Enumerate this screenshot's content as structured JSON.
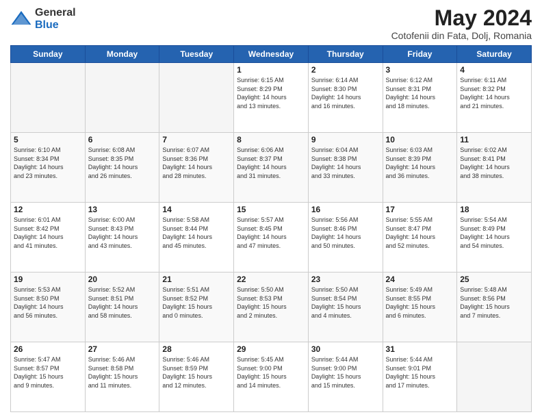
{
  "logo": {
    "general": "General",
    "blue": "Blue"
  },
  "header": {
    "month_year": "May 2024",
    "location": "Cotofenii din Fata, Dolj, Romania"
  },
  "weekdays": [
    "Sunday",
    "Monday",
    "Tuesday",
    "Wednesday",
    "Thursday",
    "Friday",
    "Saturday"
  ],
  "weeks": [
    [
      {
        "day": "",
        "info": ""
      },
      {
        "day": "",
        "info": ""
      },
      {
        "day": "",
        "info": ""
      },
      {
        "day": "1",
        "info": "Sunrise: 6:15 AM\nSunset: 8:29 PM\nDaylight: 14 hours\nand 13 minutes."
      },
      {
        "day": "2",
        "info": "Sunrise: 6:14 AM\nSunset: 8:30 PM\nDaylight: 14 hours\nand 16 minutes."
      },
      {
        "day": "3",
        "info": "Sunrise: 6:12 AM\nSunset: 8:31 PM\nDaylight: 14 hours\nand 18 minutes."
      },
      {
        "day": "4",
        "info": "Sunrise: 6:11 AM\nSunset: 8:32 PM\nDaylight: 14 hours\nand 21 minutes."
      }
    ],
    [
      {
        "day": "5",
        "info": "Sunrise: 6:10 AM\nSunset: 8:34 PM\nDaylight: 14 hours\nand 23 minutes."
      },
      {
        "day": "6",
        "info": "Sunrise: 6:08 AM\nSunset: 8:35 PM\nDaylight: 14 hours\nand 26 minutes."
      },
      {
        "day": "7",
        "info": "Sunrise: 6:07 AM\nSunset: 8:36 PM\nDaylight: 14 hours\nand 28 minutes."
      },
      {
        "day": "8",
        "info": "Sunrise: 6:06 AM\nSunset: 8:37 PM\nDaylight: 14 hours\nand 31 minutes."
      },
      {
        "day": "9",
        "info": "Sunrise: 6:04 AM\nSunset: 8:38 PM\nDaylight: 14 hours\nand 33 minutes."
      },
      {
        "day": "10",
        "info": "Sunrise: 6:03 AM\nSunset: 8:39 PM\nDaylight: 14 hours\nand 36 minutes."
      },
      {
        "day": "11",
        "info": "Sunrise: 6:02 AM\nSunset: 8:41 PM\nDaylight: 14 hours\nand 38 minutes."
      }
    ],
    [
      {
        "day": "12",
        "info": "Sunrise: 6:01 AM\nSunset: 8:42 PM\nDaylight: 14 hours\nand 41 minutes."
      },
      {
        "day": "13",
        "info": "Sunrise: 6:00 AM\nSunset: 8:43 PM\nDaylight: 14 hours\nand 43 minutes."
      },
      {
        "day": "14",
        "info": "Sunrise: 5:58 AM\nSunset: 8:44 PM\nDaylight: 14 hours\nand 45 minutes."
      },
      {
        "day": "15",
        "info": "Sunrise: 5:57 AM\nSunset: 8:45 PM\nDaylight: 14 hours\nand 47 minutes."
      },
      {
        "day": "16",
        "info": "Sunrise: 5:56 AM\nSunset: 8:46 PM\nDaylight: 14 hours\nand 50 minutes."
      },
      {
        "day": "17",
        "info": "Sunrise: 5:55 AM\nSunset: 8:47 PM\nDaylight: 14 hours\nand 52 minutes."
      },
      {
        "day": "18",
        "info": "Sunrise: 5:54 AM\nSunset: 8:49 PM\nDaylight: 14 hours\nand 54 minutes."
      }
    ],
    [
      {
        "day": "19",
        "info": "Sunrise: 5:53 AM\nSunset: 8:50 PM\nDaylight: 14 hours\nand 56 minutes."
      },
      {
        "day": "20",
        "info": "Sunrise: 5:52 AM\nSunset: 8:51 PM\nDaylight: 14 hours\nand 58 minutes."
      },
      {
        "day": "21",
        "info": "Sunrise: 5:51 AM\nSunset: 8:52 PM\nDaylight: 15 hours\nand 0 minutes."
      },
      {
        "day": "22",
        "info": "Sunrise: 5:50 AM\nSunset: 8:53 PM\nDaylight: 15 hours\nand 2 minutes."
      },
      {
        "day": "23",
        "info": "Sunrise: 5:50 AM\nSunset: 8:54 PM\nDaylight: 15 hours\nand 4 minutes."
      },
      {
        "day": "24",
        "info": "Sunrise: 5:49 AM\nSunset: 8:55 PM\nDaylight: 15 hours\nand 6 minutes."
      },
      {
        "day": "25",
        "info": "Sunrise: 5:48 AM\nSunset: 8:56 PM\nDaylight: 15 hours\nand 7 minutes."
      }
    ],
    [
      {
        "day": "26",
        "info": "Sunrise: 5:47 AM\nSunset: 8:57 PM\nDaylight: 15 hours\nand 9 minutes."
      },
      {
        "day": "27",
        "info": "Sunrise: 5:46 AM\nSunset: 8:58 PM\nDaylight: 15 hours\nand 11 minutes."
      },
      {
        "day": "28",
        "info": "Sunrise: 5:46 AM\nSunset: 8:59 PM\nDaylight: 15 hours\nand 12 minutes."
      },
      {
        "day": "29",
        "info": "Sunrise: 5:45 AM\nSunset: 9:00 PM\nDaylight: 15 hours\nand 14 minutes."
      },
      {
        "day": "30",
        "info": "Sunrise: 5:44 AM\nSunset: 9:00 PM\nDaylight: 15 hours\nand 15 minutes."
      },
      {
        "day": "31",
        "info": "Sunrise: 5:44 AM\nSunset: 9:01 PM\nDaylight: 15 hours\nand 17 minutes."
      },
      {
        "day": "",
        "info": ""
      }
    ]
  ]
}
